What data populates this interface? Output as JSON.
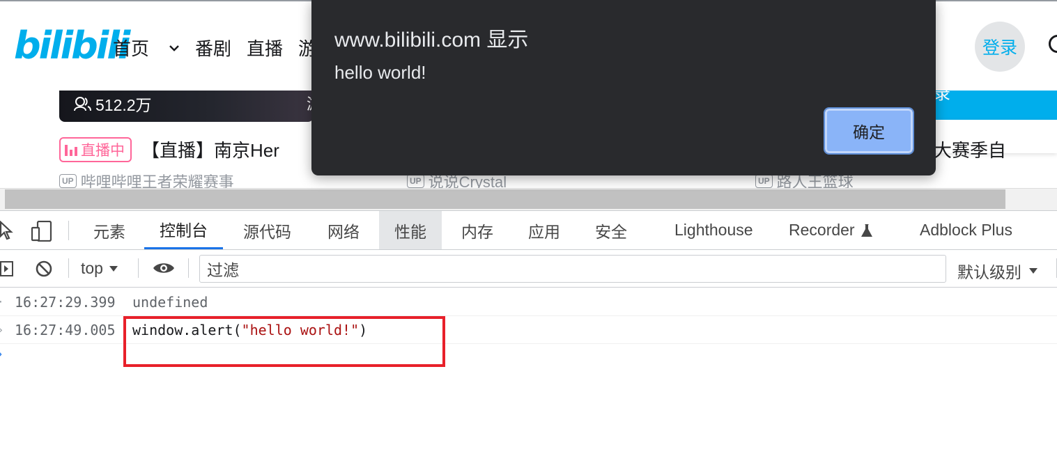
{
  "site": {
    "logo_text": "bilibili",
    "nav": [
      {
        "label": "首页",
        "has_dropdown": true
      },
      {
        "label": "番剧"
      },
      {
        "label": "直播"
      },
      {
        "label": "游"
      }
    ],
    "login_label": "登录",
    "card": {
      "views": "512.2万",
      "partial_text": "游"
    },
    "banner_partial": "录",
    "live": {
      "badge": "直播中",
      "title": "【直播】南京Her",
      "right_title_partial": "大赛季自",
      "up_tag": "UP"
    },
    "up_rows": [
      {
        "name": "哔哩哔哩王者荣耀赛事"
      },
      {
        "name": "说说Crystal"
      },
      {
        "name": "路人王篮球"
      }
    ]
  },
  "devtools": {
    "tabs": [
      {
        "label": "元素"
      },
      {
        "label": "控制台",
        "active": true
      },
      {
        "label": "源代码"
      },
      {
        "label": "网络"
      },
      {
        "label": "性能",
        "hover": true
      },
      {
        "label": "内存"
      },
      {
        "label": "应用"
      },
      {
        "label": "安全"
      },
      {
        "label": "Lighthouse"
      },
      {
        "label": "Recorder"
      },
      {
        "label": "Adblock Plus"
      }
    ],
    "toolbar": {
      "context": "top",
      "filter_placeholder": "过滤",
      "level": "默认级别"
    },
    "console": [
      {
        "time": "16:27:29.399",
        "text": "undefined"
      },
      {
        "time": "16:27:49.005",
        "code_prefix": "window.alert(",
        "code_string": "\"hello world!\"",
        "code_suffix": ")"
      }
    ]
  },
  "dialog": {
    "title": "www.bilibili.com 显示",
    "message": "hello world!",
    "ok_label": "确定"
  },
  "colors": {
    "brand": "#00aeec",
    "live_pink": "#ff6699",
    "devtools_accent": "#1a73e8",
    "dialog_bg": "#292a2d",
    "dialog_button": "#8ab4f8",
    "highlight_red": "#e8202a"
  }
}
